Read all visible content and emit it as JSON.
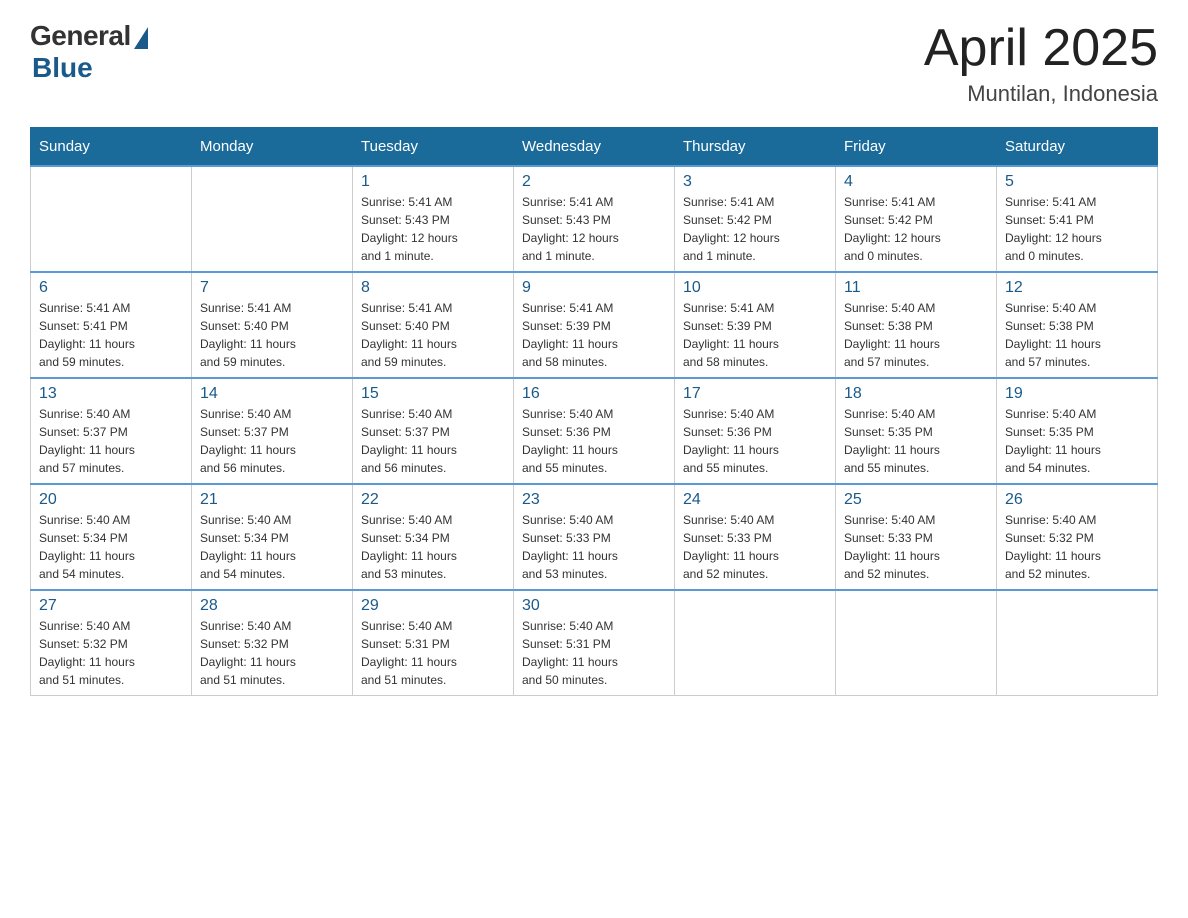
{
  "header": {
    "logo": {
      "general": "General",
      "blue": "Blue"
    },
    "title": "April 2025",
    "location": "Muntilan, Indonesia"
  },
  "weekdays": [
    "Sunday",
    "Monday",
    "Tuesday",
    "Wednesday",
    "Thursday",
    "Friday",
    "Saturday"
  ],
  "weeks": [
    [
      {
        "day": "",
        "info": ""
      },
      {
        "day": "",
        "info": ""
      },
      {
        "day": "1",
        "info": "Sunrise: 5:41 AM\nSunset: 5:43 PM\nDaylight: 12 hours\nand 1 minute."
      },
      {
        "day": "2",
        "info": "Sunrise: 5:41 AM\nSunset: 5:43 PM\nDaylight: 12 hours\nand 1 minute."
      },
      {
        "day": "3",
        "info": "Sunrise: 5:41 AM\nSunset: 5:42 PM\nDaylight: 12 hours\nand 1 minute."
      },
      {
        "day": "4",
        "info": "Sunrise: 5:41 AM\nSunset: 5:42 PM\nDaylight: 12 hours\nand 0 minutes."
      },
      {
        "day": "5",
        "info": "Sunrise: 5:41 AM\nSunset: 5:41 PM\nDaylight: 12 hours\nand 0 minutes."
      }
    ],
    [
      {
        "day": "6",
        "info": "Sunrise: 5:41 AM\nSunset: 5:41 PM\nDaylight: 11 hours\nand 59 minutes."
      },
      {
        "day": "7",
        "info": "Sunrise: 5:41 AM\nSunset: 5:40 PM\nDaylight: 11 hours\nand 59 minutes."
      },
      {
        "day": "8",
        "info": "Sunrise: 5:41 AM\nSunset: 5:40 PM\nDaylight: 11 hours\nand 59 minutes."
      },
      {
        "day": "9",
        "info": "Sunrise: 5:41 AM\nSunset: 5:39 PM\nDaylight: 11 hours\nand 58 minutes."
      },
      {
        "day": "10",
        "info": "Sunrise: 5:41 AM\nSunset: 5:39 PM\nDaylight: 11 hours\nand 58 minutes."
      },
      {
        "day": "11",
        "info": "Sunrise: 5:40 AM\nSunset: 5:38 PM\nDaylight: 11 hours\nand 57 minutes."
      },
      {
        "day": "12",
        "info": "Sunrise: 5:40 AM\nSunset: 5:38 PM\nDaylight: 11 hours\nand 57 minutes."
      }
    ],
    [
      {
        "day": "13",
        "info": "Sunrise: 5:40 AM\nSunset: 5:37 PM\nDaylight: 11 hours\nand 57 minutes."
      },
      {
        "day": "14",
        "info": "Sunrise: 5:40 AM\nSunset: 5:37 PM\nDaylight: 11 hours\nand 56 minutes."
      },
      {
        "day": "15",
        "info": "Sunrise: 5:40 AM\nSunset: 5:37 PM\nDaylight: 11 hours\nand 56 minutes."
      },
      {
        "day": "16",
        "info": "Sunrise: 5:40 AM\nSunset: 5:36 PM\nDaylight: 11 hours\nand 55 minutes."
      },
      {
        "day": "17",
        "info": "Sunrise: 5:40 AM\nSunset: 5:36 PM\nDaylight: 11 hours\nand 55 minutes."
      },
      {
        "day": "18",
        "info": "Sunrise: 5:40 AM\nSunset: 5:35 PM\nDaylight: 11 hours\nand 55 minutes."
      },
      {
        "day": "19",
        "info": "Sunrise: 5:40 AM\nSunset: 5:35 PM\nDaylight: 11 hours\nand 54 minutes."
      }
    ],
    [
      {
        "day": "20",
        "info": "Sunrise: 5:40 AM\nSunset: 5:34 PM\nDaylight: 11 hours\nand 54 minutes."
      },
      {
        "day": "21",
        "info": "Sunrise: 5:40 AM\nSunset: 5:34 PM\nDaylight: 11 hours\nand 54 minutes."
      },
      {
        "day": "22",
        "info": "Sunrise: 5:40 AM\nSunset: 5:34 PM\nDaylight: 11 hours\nand 53 minutes."
      },
      {
        "day": "23",
        "info": "Sunrise: 5:40 AM\nSunset: 5:33 PM\nDaylight: 11 hours\nand 53 minutes."
      },
      {
        "day": "24",
        "info": "Sunrise: 5:40 AM\nSunset: 5:33 PM\nDaylight: 11 hours\nand 52 minutes."
      },
      {
        "day": "25",
        "info": "Sunrise: 5:40 AM\nSunset: 5:33 PM\nDaylight: 11 hours\nand 52 minutes."
      },
      {
        "day": "26",
        "info": "Sunrise: 5:40 AM\nSunset: 5:32 PM\nDaylight: 11 hours\nand 52 minutes."
      }
    ],
    [
      {
        "day": "27",
        "info": "Sunrise: 5:40 AM\nSunset: 5:32 PM\nDaylight: 11 hours\nand 51 minutes."
      },
      {
        "day": "28",
        "info": "Sunrise: 5:40 AM\nSunset: 5:32 PM\nDaylight: 11 hours\nand 51 minutes."
      },
      {
        "day": "29",
        "info": "Sunrise: 5:40 AM\nSunset: 5:31 PM\nDaylight: 11 hours\nand 51 minutes."
      },
      {
        "day": "30",
        "info": "Sunrise: 5:40 AM\nSunset: 5:31 PM\nDaylight: 11 hours\nand 50 minutes."
      },
      {
        "day": "",
        "info": ""
      },
      {
        "day": "",
        "info": ""
      },
      {
        "day": "",
        "info": ""
      }
    ]
  ]
}
